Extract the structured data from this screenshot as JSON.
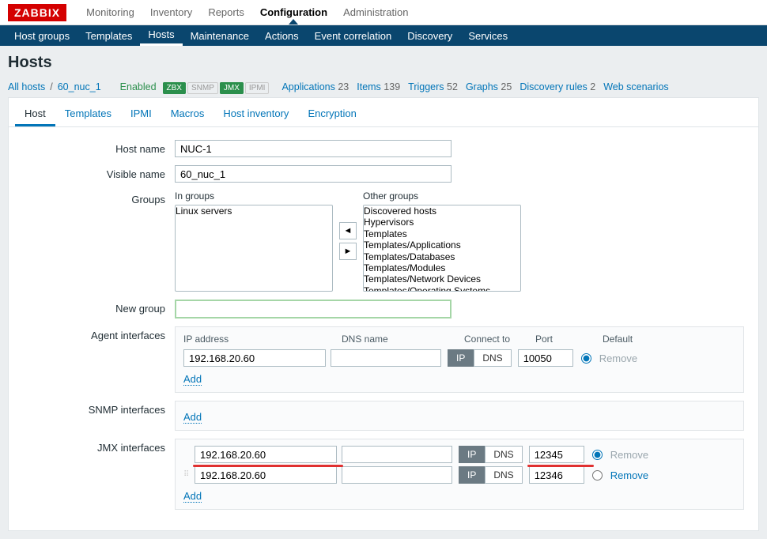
{
  "logo": "ZABBIX",
  "topnav": [
    "Monitoring",
    "Inventory",
    "Reports",
    "Configuration",
    "Administration"
  ],
  "topnav_active": 3,
  "subnav": [
    "Host groups",
    "Templates",
    "Hosts",
    "Maintenance",
    "Actions",
    "Event correlation",
    "Discovery",
    "Services"
  ],
  "subnav_active": 2,
  "page_title": "Hosts",
  "breadcrumb": {
    "all_hosts": "All hosts",
    "host": "60_nuc_1",
    "status": "Enabled"
  },
  "protocols": [
    {
      "name": "ZBX",
      "on": true
    },
    {
      "name": "SNMP",
      "on": false
    },
    {
      "name": "JMX",
      "on": true
    },
    {
      "name": "IPMI",
      "on": false
    }
  ],
  "meta": [
    {
      "label": "Applications",
      "count": "23"
    },
    {
      "label": "Items",
      "count": "139"
    },
    {
      "label": "Triggers",
      "count": "52"
    },
    {
      "label": "Graphs",
      "count": "25"
    },
    {
      "label": "Discovery rules",
      "count": "2"
    },
    {
      "label": "Web scenarios",
      "count": ""
    }
  ],
  "tabs": [
    "Host",
    "Templates",
    "IPMI",
    "Macros",
    "Host inventory",
    "Encryption"
  ],
  "tabs_active": 0,
  "labels": {
    "host_name": "Host name",
    "visible_name": "Visible name",
    "groups": "Groups",
    "in_groups": "In groups",
    "other_groups": "Other groups",
    "new_group": "New group",
    "agent_if": "Agent interfaces",
    "snmp_if": "SNMP interfaces",
    "jmx_if": "JMX interfaces",
    "ip_addr": "IP address",
    "dns_name": "DNS name",
    "connect_to": "Connect to",
    "port": "Port",
    "default": "Default",
    "ip": "IP",
    "dns": "DNS",
    "add": "Add",
    "remove": "Remove"
  },
  "form": {
    "host_name": "NUC-1",
    "visible_name": "60_nuc_1",
    "in_groups": [
      "Linux servers"
    ],
    "other_groups": [
      "Discovered hosts",
      "Hypervisors",
      "Templates",
      "Templates/Applications",
      "Templates/Databases",
      "Templates/Modules",
      "Templates/Network Devices",
      "Templates/Operating Systems"
    ],
    "new_group": ""
  },
  "agent_if": [
    {
      "ip": "192.168.20.60",
      "dns": "",
      "conn": "IP",
      "port": "10050",
      "default": true,
      "remove_enabled": false
    }
  ],
  "jmx_if": [
    {
      "ip": "192.168.20.60",
      "dns": "",
      "conn": "IP",
      "port": "12345",
      "default": true,
      "remove_enabled": false,
      "highlight": true,
      "drag": false
    },
    {
      "ip": "192.168.20.60",
      "dns": "",
      "conn": "IP",
      "port": "12346",
      "default": false,
      "remove_enabled": true,
      "highlight": false,
      "drag": true
    }
  ]
}
